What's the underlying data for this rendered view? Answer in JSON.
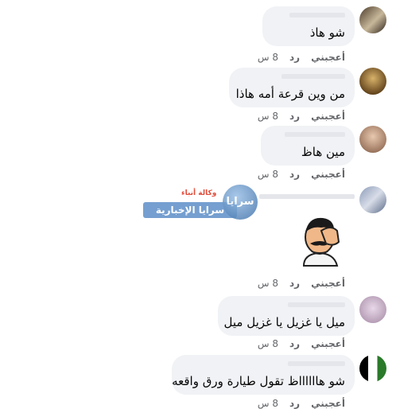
{
  "actions": {
    "like": "أعجبني",
    "reply": "رد"
  },
  "comments": [
    {
      "text": "شو هاذ",
      "time": "8 س"
    },
    {
      "text": "من وين قرعة أمه هاذا",
      "time": "8 س"
    },
    {
      "text": "مين هاظ",
      "time": "8 س"
    },
    {
      "text": "",
      "time": "8 س",
      "sticker": "facepalm-sticker"
    },
    {
      "text": "ميل يا غزيل يا غزيل ميل",
      "time": "8 س"
    },
    {
      "text": "شو هااااااظ تقول طيارة ورق واقعه",
      "time": "8 س"
    }
  ],
  "watermark": {
    "top": "وكالة أنباء",
    "main": "سرايا الإخبارية",
    "circle": "سرايا"
  },
  "colors": {
    "bubble": "#f0f2f5",
    "meta": "#65676b",
    "text": "#050505"
  }
}
